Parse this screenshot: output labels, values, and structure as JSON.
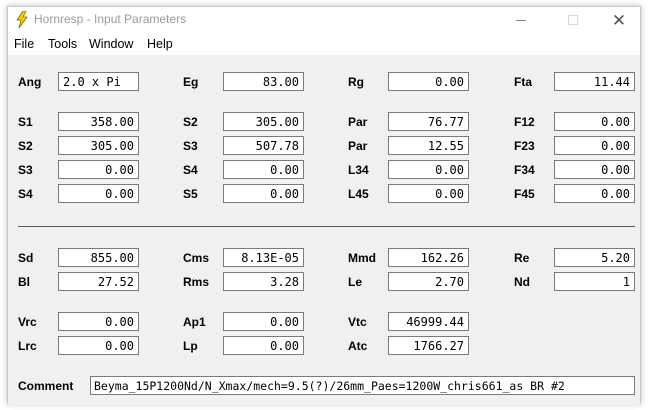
{
  "window": {
    "title": "Hornresp - Input Parameters",
    "close_glyph": "✕"
  },
  "menu": [
    "File",
    "Tools",
    "Window",
    "Help"
  ],
  "rows": {
    "r1": [
      {
        "label": "Ang",
        "value": "2.0 x Pi",
        "align": "left"
      },
      {
        "label": "Eg",
        "value": "83.00"
      },
      {
        "label": "Rg",
        "value": "0.00"
      },
      {
        "label": "Fta",
        "value": "11.44"
      }
    ],
    "r2": [
      {
        "label": "S1",
        "value": "358.00"
      },
      {
        "label": "S2",
        "value": "305.00"
      },
      {
        "label": "Par",
        "value": "76.77"
      },
      {
        "label": "F12",
        "value": "0.00"
      }
    ],
    "r3": [
      {
        "label": "S2",
        "value": "305.00"
      },
      {
        "label": "S3",
        "value": "507.78"
      },
      {
        "label": "Par",
        "value": "12.55"
      },
      {
        "label": "F23",
        "value": "0.00"
      }
    ],
    "r4": [
      {
        "label": "S3",
        "value": "0.00"
      },
      {
        "label": "S4",
        "value": "0.00"
      },
      {
        "label": "L34",
        "value": "0.00"
      },
      {
        "label": "F34",
        "value": "0.00"
      }
    ],
    "r5": [
      {
        "label": "S4",
        "value": "0.00"
      },
      {
        "label": "S5",
        "value": "0.00"
      },
      {
        "label": "L45",
        "value": "0.00"
      },
      {
        "label": "F45",
        "value": "0.00"
      }
    ],
    "r6": [
      {
        "label": "Sd",
        "value": "855.00"
      },
      {
        "label": "Cms",
        "value": "8.13E-05"
      },
      {
        "label": "Mmd",
        "value": "162.26"
      },
      {
        "label": "Re",
        "value": "5.20"
      }
    ],
    "r7": [
      {
        "label": "Bl",
        "value": "27.52"
      },
      {
        "label": "Rms",
        "value": "3.28"
      },
      {
        "label": "Le",
        "value": "2.70"
      },
      {
        "label": "Nd",
        "value": "1"
      }
    ],
    "r8": [
      {
        "label": "Vrc",
        "value": "0.00"
      },
      {
        "label": "Ap1",
        "value": "0.00"
      },
      {
        "label": "Vtc",
        "value": "46999.44"
      }
    ],
    "r9": [
      {
        "label": "Lrc",
        "value": "0.00"
      },
      {
        "label": "Lp",
        "value": "0.00"
      },
      {
        "label": "Atc",
        "value": "1766.27"
      }
    ]
  },
  "comment": {
    "label": "Comment",
    "value": "Beyma_15P1200Nd/N_Xmax/mech=9.5(?)/26mm_Paes=1200W_chris661_as BR #2"
  },
  "colors": {
    "icon_yellow": "#f5d000",
    "icon_outline": "#8a6d00"
  }
}
